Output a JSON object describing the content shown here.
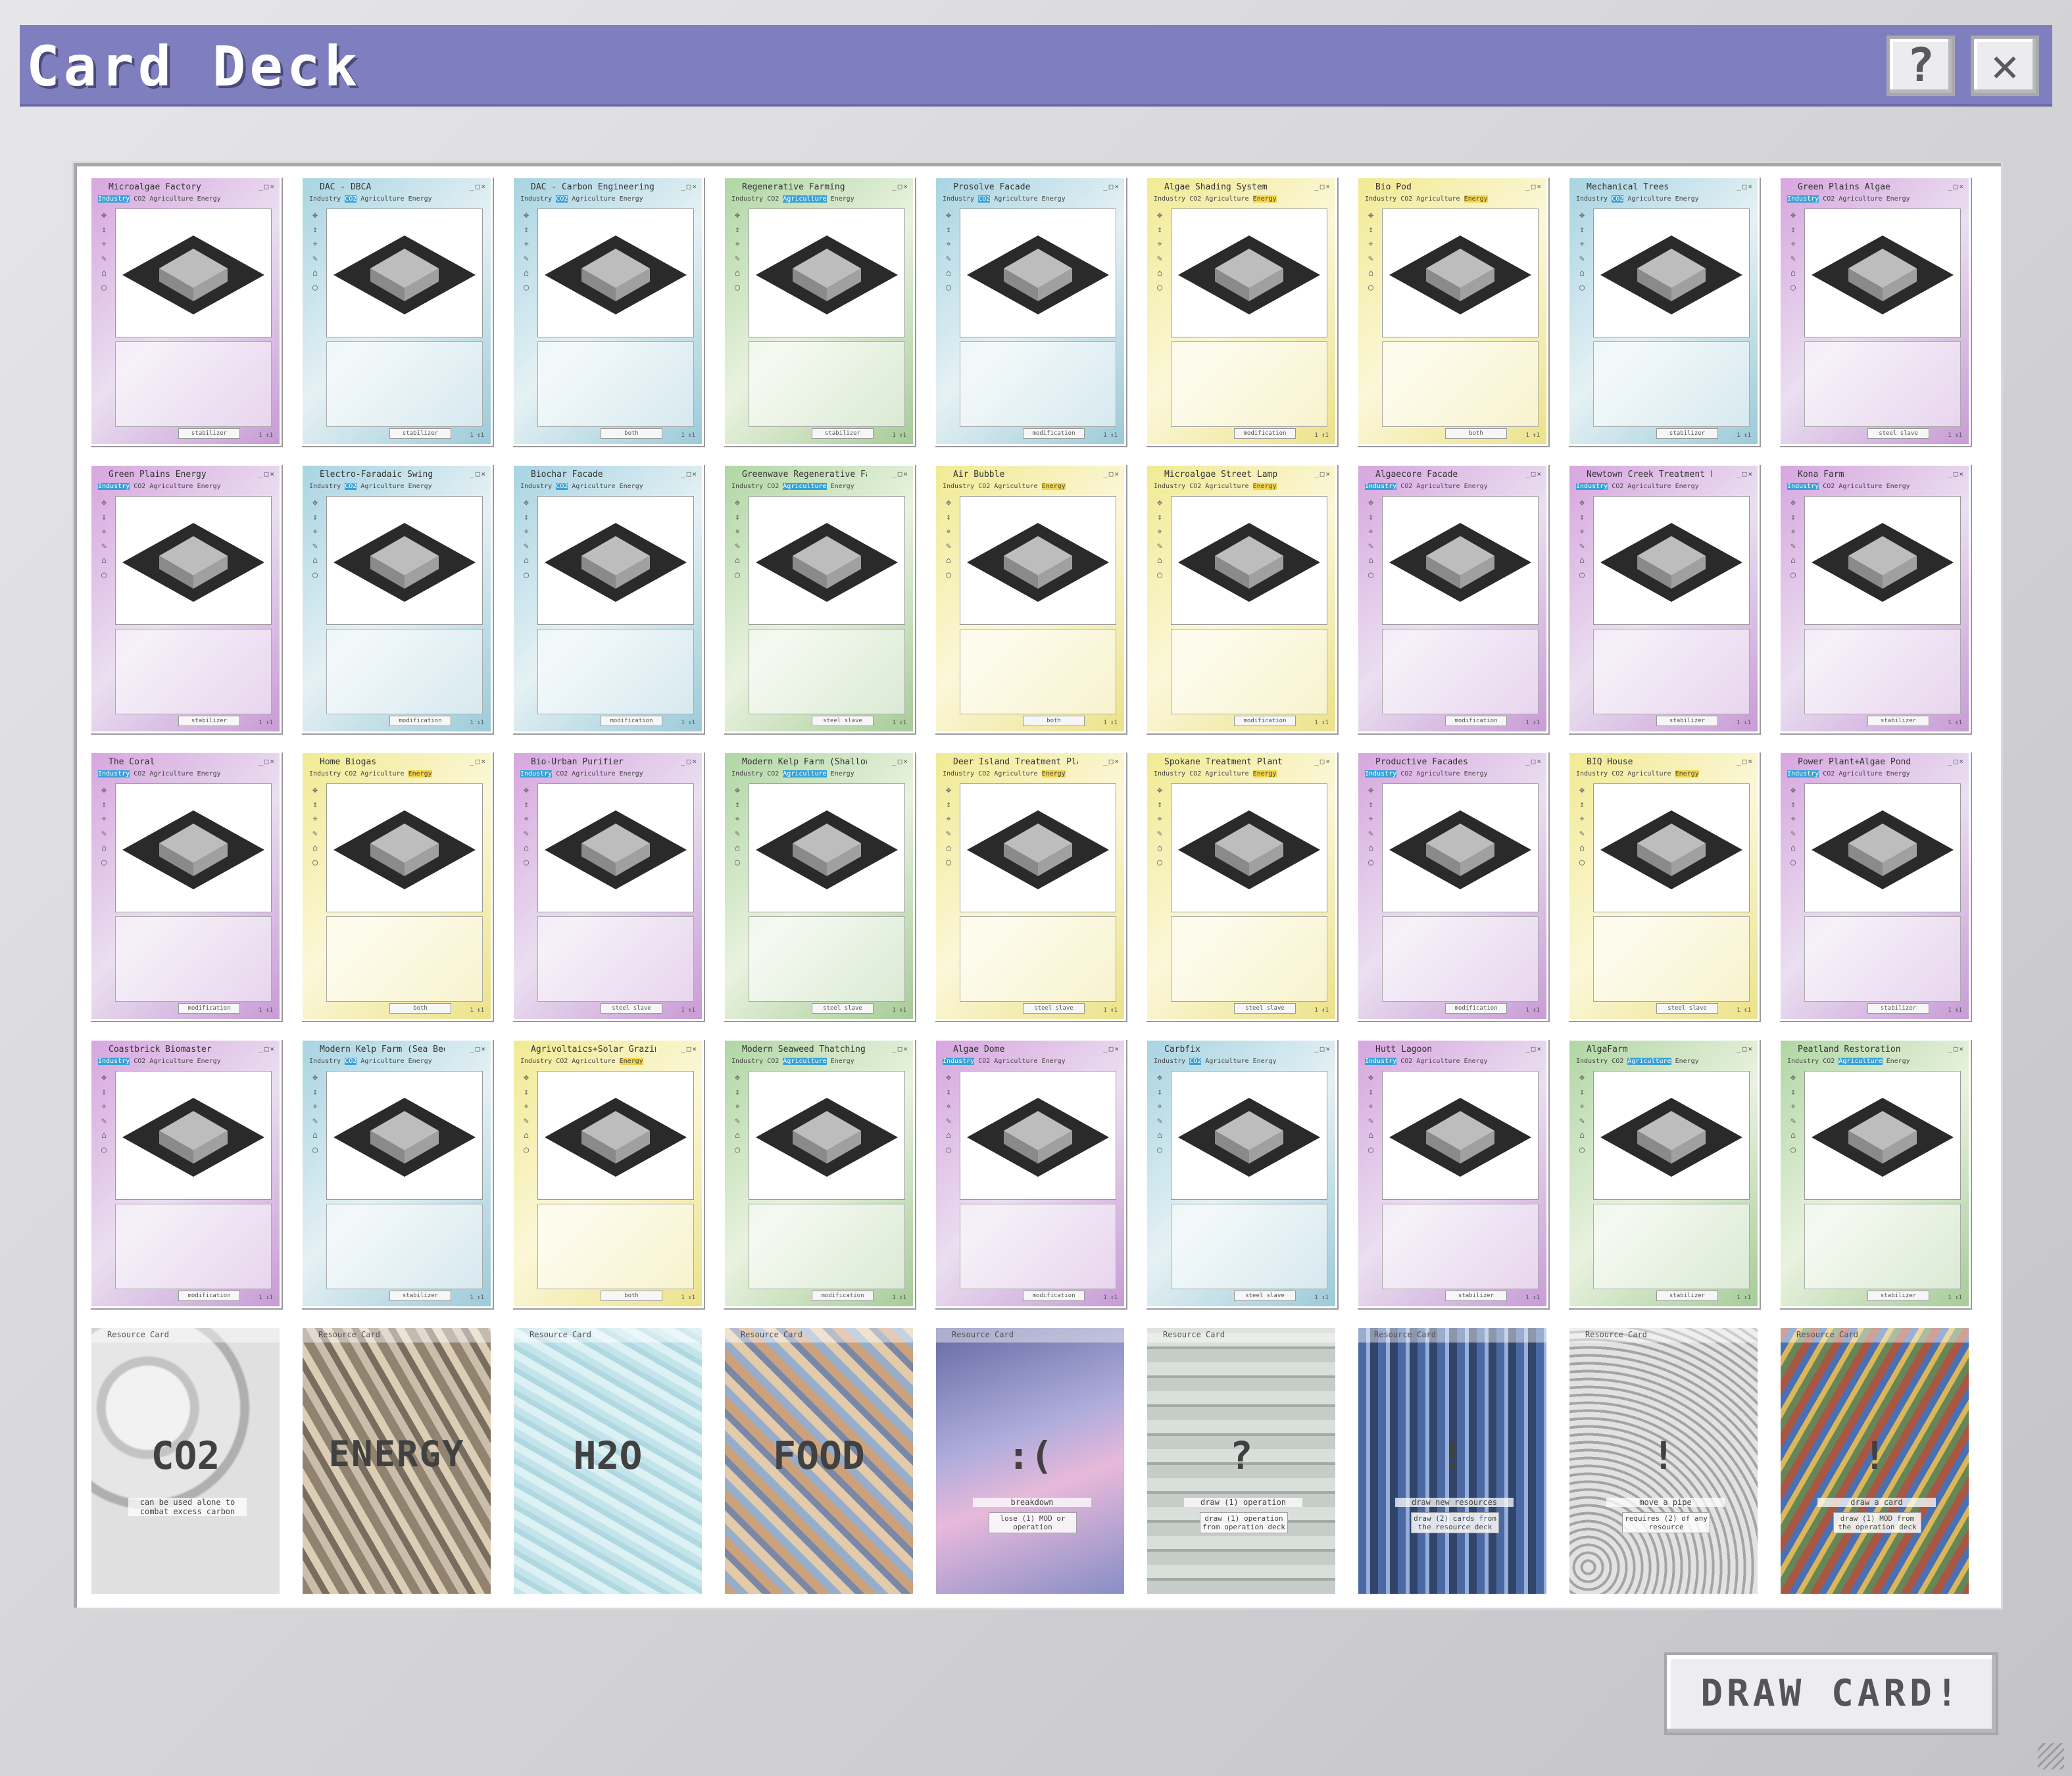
{
  "window": {
    "title": "Card Deck",
    "help_label": "?",
    "close_label": "✕",
    "draw_button_label": "DRAW CARD!"
  },
  "card_chrome": {
    "categories": [
      "Industry",
      "CO2",
      "Agriculture",
      "Energy"
    ],
    "window_controls": "_□×",
    "tool_icons": [
      "✥",
      "↕",
      "⌖",
      "✎",
      "⌂",
      "◯"
    ]
  },
  "colors": {
    "titlebar": "#7f7fbf",
    "pink": "#d7a6df",
    "blue": "#a8d4e2",
    "green": "#b0d6a4",
    "yellow": "#f1ea93",
    "category_highlight": "#3aa1d6"
  },
  "operation_cards": [
    {
      "title": "Microalgae Factory",
      "color": "pink",
      "tag": "stabilizer",
      "page": "1 ↕1"
    },
    {
      "title": "DAC - DBCA",
      "color": "blue",
      "tag": "stabilizer",
      "page": "1 ↕1"
    },
    {
      "title": "DAC - Carbon Engineering",
      "color": "blue",
      "tag": "both",
      "page": "1 ↕1"
    },
    {
      "title": "Regenerative Farming",
      "color": "green",
      "tag": "stabilizer",
      "page": "1 ↕1"
    },
    {
      "title": "Prosolve Facade",
      "color": "blue",
      "tag": "modification",
      "page": "1 ↕1"
    },
    {
      "title": "Algae Shading System",
      "color": "yellow",
      "tag": "modification",
      "page": "1 ↕1"
    },
    {
      "title": "Bio Pod",
      "color": "yellow",
      "tag": "both",
      "page": "1 ↕1"
    },
    {
      "title": "Mechanical Trees",
      "color": "blue",
      "tag": "stabilizer",
      "page": "1 ↕1"
    },
    {
      "title": "Green Plains Algae",
      "color": "pink",
      "tag": "steel slave",
      "page": "1 ↕1"
    },
    {
      "title": "Green Plains Energy",
      "color": "pink",
      "tag": "stabilizer",
      "page": "1 ↕1"
    },
    {
      "title": "Electro-Faradaic Swing",
      "color": "blue",
      "tag": "modification",
      "page": "1 ↕1"
    },
    {
      "title": "Biochar Facade",
      "color": "blue",
      "tag": "modification",
      "page": "1 ↕1"
    },
    {
      "title": "Greenwave Regenerative Farming",
      "color": "green",
      "tag": "steel slave",
      "page": "1 ↕1"
    },
    {
      "title": "Air Bubble",
      "color": "yellow",
      "tag": "both",
      "page": "1 ↕1"
    },
    {
      "title": "Microalgae Street Lamp",
      "color": "yellow",
      "tag": "modification",
      "page": "1 ↕1"
    },
    {
      "title": "Algaecore Facade",
      "color": "pink",
      "tag": "modification",
      "page": "1 ↕1"
    },
    {
      "title": "Newtown Creek Treatment Plant",
      "color": "pink",
      "tag": "stabilizer",
      "page": "1 ↕1"
    },
    {
      "title": "Kona Farm",
      "color": "pink",
      "tag": "stabilizer",
      "page": "1 ↕1"
    },
    {
      "title": "The Coral",
      "color": "pink",
      "tag": "modification",
      "page": "1 ↕1"
    },
    {
      "title": "Home Biogas",
      "color": "yellow",
      "tag": "both",
      "page": "1 ↕1"
    },
    {
      "title": "Bio-Urban Purifier",
      "color": "pink",
      "tag": "steel slave",
      "page": "1 ↕1"
    },
    {
      "title": "Modern Kelp Farm (Shallow)",
      "color": "green",
      "tag": "steel slave",
      "page": "1 ↕1"
    },
    {
      "title": "Deer Island Treatment Plant",
      "color": "yellow",
      "tag": "steel slave",
      "page": "1 ↕1"
    },
    {
      "title": "Spokane Treatment Plant",
      "color": "yellow",
      "tag": "steel slave",
      "page": "1 ↕1"
    },
    {
      "title": "Productive Facades",
      "color": "pink",
      "tag": "modification",
      "page": "1 ↕1"
    },
    {
      "title": "BIQ House",
      "color": "yellow",
      "tag": "steel slave",
      "page": "1 ↕1"
    },
    {
      "title": "Power Plant+Algae Pond",
      "color": "pink",
      "tag": "stabilizer",
      "page": "1 ↕1"
    },
    {
      "title": "Coastbrick Biomaster",
      "color": "pink",
      "tag": "modification",
      "page": "1 ↕1"
    },
    {
      "title": "Modern Kelp Farm (Sea Bed)",
      "color": "blue",
      "tag": "stabilizer",
      "page": "1 ↕1"
    },
    {
      "title": "Agrivoltaics+Solar Grazing",
      "color": "yellow",
      "tag": "both",
      "page": "1 ↕1"
    },
    {
      "title": "Modern Seaweed Thatching",
      "color": "green",
      "tag": "modification",
      "page": "1 ↕1"
    },
    {
      "title": "Algae Dome",
      "color": "pink",
      "tag": "modification",
      "page": "1 ↕1"
    },
    {
      "title": "Carbfix",
      "color": "blue",
      "tag": "steel slave",
      "page": "1 ↕1"
    },
    {
      "title": "Hutt Lagoon",
      "color": "pink",
      "tag": "stabilizer",
      "page": "1 ↕1"
    },
    {
      "title": "AlgaFarm",
      "color": "green",
      "tag": "stabilizer",
      "page": "1 ↕1"
    },
    {
      "title": "Peatland Restoration",
      "color": "green",
      "tag": "stabilizer",
      "page": "1 ↕1"
    }
  ],
  "resource_cards": [
    {
      "header": "Resource Card",
      "symbol": "CO2",
      "caption": "can be used alone to combat excess carbon",
      "detail": ""
    },
    {
      "header": "Resource Card",
      "symbol": "ENERGY",
      "caption": "",
      "detail": ""
    },
    {
      "header": "Resource Card",
      "symbol": "H2O",
      "caption": "",
      "detail": ""
    },
    {
      "header": "Resource Card",
      "symbol": "FOOD",
      "caption": "",
      "detail": ""
    },
    {
      "header": "Resource Card",
      "symbol": ":(",
      "caption": "breakdown",
      "detail": "lose (1) MOD or operation"
    },
    {
      "header": "Resource Card",
      "symbol": "?",
      "caption": "draw (1) operation",
      "detail": "draw (1) operation from operation deck"
    },
    {
      "header": "Resource Card",
      "symbol": "!",
      "caption": "draw new resources",
      "detail": "draw (2) cards from the resource deck"
    },
    {
      "header": "Resource Card",
      "symbol": "!",
      "caption": "move a pipe",
      "detail": "requires (2) of any resource"
    },
    {
      "header": "Resource Card",
      "symbol": "!",
      "caption": "draw a card",
      "detail": "draw (1) MOD from the operation deck"
    }
  ]
}
